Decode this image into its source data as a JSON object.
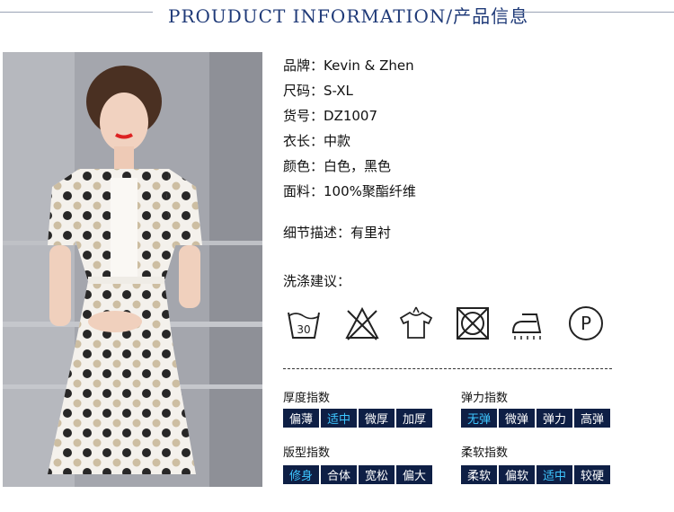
{
  "header": {
    "title": "PROUDUCT INFORMATION/产品信息"
  },
  "specs": [
    {
      "label": "品牌：",
      "value": "Kevin & Zhen"
    },
    {
      "label": "尺码：",
      "value": "S-XL"
    },
    {
      "label": "货号：",
      "value": "DZ1007"
    },
    {
      "label": "衣长：",
      "value": "中款"
    },
    {
      "label": "颜色：",
      "value": "白色，黑色"
    },
    {
      "label": "面料：",
      "value": "100%聚酯纤维"
    }
  ],
  "detail": {
    "label": "细节描述：",
    "value": "有里衬"
  },
  "wash": {
    "title": "洗涤建议：",
    "icons": [
      "wash-30-icon",
      "no-bleach-icon",
      "hang-dry-icon",
      "no-tumble-dry-icon",
      "low-iron-icon",
      "dry-clean-p-icon"
    ],
    "temperature": "30",
    "dry_clean_letter": "P"
  },
  "indices": [
    {
      "title": "厚度指数",
      "options": [
        "偏薄",
        "适中",
        "微厚",
        "加厚"
      ],
      "selected": 1
    },
    {
      "title": "弹力指数",
      "options": [
        "无弹",
        "微弹",
        "弹力",
        "高弹"
      ],
      "selected": 0
    },
    {
      "title": "版型指数",
      "options": [
        "修身",
        "合体",
        "宽松",
        "偏大"
      ],
      "selected": 0
    },
    {
      "title": "柔软指数",
      "options": [
        "柔软",
        "偏软",
        "适中",
        "较硬"
      ],
      "selected": 2
    }
  ],
  "colors": {
    "title": "#1f3a78",
    "chip_bg": "#0e1f45",
    "chip_text": "#ffffff",
    "chip_selected_text": "#3ec6ff"
  }
}
